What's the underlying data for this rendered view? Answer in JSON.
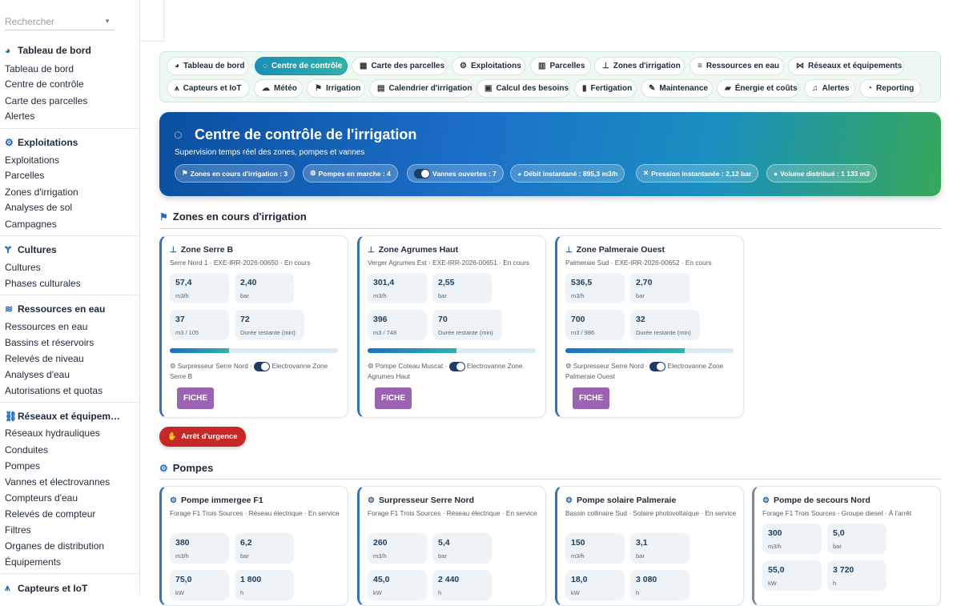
{
  "sidebar": {
    "search_placeholder": "Rechercher",
    "sections": [
      {
        "title": "Tableau de bord",
        "icon": "gauge-icon",
        "items": [
          "Tableau de bord",
          "Centre de contrôle",
          "Carte des parcelles",
          "Alertes"
        ]
      },
      {
        "title": "Exploitations",
        "icon": "tractor-icon",
        "items": [
          "Exploitations",
          "Parcelles",
          "Zones d'irrigation",
          "Analyses de sol",
          "Campagnes"
        ]
      },
      {
        "title": "Cultures",
        "icon": "seedling-icon",
        "items": [
          "Cultures",
          "Phases culturales"
        ]
      },
      {
        "title": "Ressources en eau",
        "icon": "water-icon",
        "items": [
          "Ressources en eau",
          "Bassins et réservoirs",
          "Relevés de niveau",
          "Analyses d'eau",
          "Autorisations et quotas"
        ]
      },
      {
        "title": "Réseaux et équipem…",
        "icon": "network-icon",
        "items": [
          "Réseaux hydrauliques",
          "Conduites",
          "Pompes",
          "Vannes et électrovannes",
          "Compteurs d'eau",
          "Relevés de compteur",
          "Filtres",
          "Organes de distribution",
          "Équipements"
        ]
      },
      {
        "title": "Capteurs et IoT",
        "icon": "antenna-icon",
        "items": []
      }
    ]
  },
  "tabs": [
    {
      "label": "Tableau de bord",
      "icon": "gauge-icon",
      "active": false
    },
    {
      "label": "Centre de contrôle",
      "icon": "satellite-dish-icon",
      "active": true
    },
    {
      "label": "Carte des parcelles",
      "icon": "map-grid-icon",
      "active": false
    },
    {
      "label": "Exploitations",
      "icon": "tractor-icon",
      "active": false
    },
    {
      "label": "Parcelles",
      "icon": "map-icon",
      "active": false
    },
    {
      "label": "Zones d'irrigation",
      "icon": "sitemap-icon",
      "active": false
    },
    {
      "label": "Ressources en eau",
      "icon": "water-icon",
      "active": false
    },
    {
      "label": "Réseaux et équipements",
      "icon": "network-icon",
      "active": false
    },
    {
      "label": "Capteurs et IoT",
      "icon": "antenna-icon",
      "active": false
    },
    {
      "label": "Météo",
      "icon": "cloud-sun-icon",
      "active": false
    },
    {
      "label": "Irrigation",
      "icon": "faucet-icon",
      "active": false
    },
    {
      "label": "Calendrier d'irrigation",
      "icon": "calendar-icon",
      "active": false
    },
    {
      "label": "Calcul des besoins",
      "icon": "calculator-icon",
      "active": false
    },
    {
      "label": "Fertigation",
      "icon": "flask-icon",
      "active": false
    },
    {
      "label": "Maintenance",
      "icon": "wrench-icon",
      "active": false
    },
    {
      "label": "Énergie et coûts",
      "icon": "money-icon",
      "active": false
    },
    {
      "label": "Alertes",
      "icon": "bell-icon",
      "active": false
    },
    {
      "label": "Reporting",
      "icon": "pie-chart-icon",
      "active": false
    }
  ],
  "hero": {
    "title": "Centre de contrôle de l'irrigation",
    "subtitle": "Supervision temps réel des zones, pompes et vannes",
    "chips": [
      {
        "text": "Zones en cours d'irrigation : 3",
        "icon": "faucet-icon"
      },
      {
        "text": "Pompes en marche : 4",
        "icon": "cogs-icon"
      },
      {
        "text": "Vannes ouvertes : 7",
        "icon": "toggle-icon"
      },
      {
        "text": "Débit instantané : 895,3 m3/h",
        "icon": "gauge-icon"
      },
      {
        "text": "Pression instantanée : 2,12 bar",
        "icon": "compress-icon"
      },
      {
        "text": "Volume distribué : 1 133 m3",
        "icon": "droplet-icon"
      }
    ]
  },
  "zones_section": {
    "title": "Zones en cours d'irrigation"
  },
  "zones": [
    {
      "name": "Zone Serre B",
      "sub": "Serre Nord 1 · EXE-IRR-2026-00650 · En cours",
      "flow": "57,4",
      "flow_unit": "m3/h",
      "pressure": "2,40",
      "pressure_unit": "bar",
      "volume": "37",
      "volume_unit": "m3 / 105",
      "remaining": "72",
      "remaining_unit": "Durée restante (min)",
      "progress": 0.35,
      "equip_pump": "Surpresseur Serre Nord ·",
      "equip_valve": "Electrovanne Zone Serre B",
      "button": "FICHE"
    },
    {
      "name": "Zone Agrumes Haut",
      "sub": "Verger Agrumes Est · EXE-IRR-2026-00651 · En cours",
      "flow": "301,4",
      "flow_unit": "m3/h",
      "pressure": "2,55",
      "pressure_unit": "bar",
      "volume": "396",
      "volume_unit": "m3 / 748",
      "remaining": "70",
      "remaining_unit": "Durée restante (min)",
      "progress": 0.53,
      "equip_pump": "Pompe Coteau Muscat ·",
      "equip_valve": "Electrovanne Zone Agrumes Haut",
      "button": "FICHE"
    },
    {
      "name": "Zone Palmeraie Ouest",
      "sub": "Palmeraie Sud · EXE-IRR-2026-00652 · En cours",
      "flow": "536,5",
      "flow_unit": "m3/h",
      "pressure": "2,70",
      "pressure_unit": "bar",
      "volume": "700",
      "volume_unit": "m3 / 986",
      "remaining": "32",
      "remaining_unit": "Durée restante (min)",
      "progress": 0.71,
      "equip_pump": "Surpresseur Serre Nord ·",
      "equip_valve": "Electrovanne Zone Palmeraie Ouest",
      "button": "FICHE"
    }
  ],
  "emergency_button": "Arrêt d'urgence",
  "pumps_section": {
    "title": "Pompes"
  },
  "pumps": [
    {
      "name": "Pompe immergee F1",
      "sub": "Forage F1 Trois Sources · Réseau électrique · En service",
      "flow": "380",
      "flow_unit": "m3/h",
      "pressure": "6,2",
      "pressure_unit": "bar",
      "power": "75,0",
      "power_unit": "kW",
      "hours": "1 800",
      "hours_unit": "h"
    },
    {
      "name": "Surpresseur Serre Nord",
      "sub": "Forage F1 Trois Sources · Réseau électrique · En service",
      "flow": "260",
      "flow_unit": "m3/h",
      "pressure": "5,4",
      "pressure_unit": "bar",
      "power": "45,0",
      "power_unit": "kW",
      "hours": "2 440",
      "hours_unit": "h"
    },
    {
      "name": "Pompe solaire Palmeraie",
      "sub": "Bassin collinaire Sud · Solaire photovoltaïque · En service",
      "flow": "150",
      "flow_unit": "m3/h",
      "pressure": "3,1",
      "pressure_unit": "bar",
      "power": "18,0",
      "power_unit": "kW",
      "hours": "3 080",
      "hours_unit": "h"
    },
    {
      "name": "Pompe de secours Nord",
      "sub": "Forage F1 Trois Sources · Groupe diesel · À l'arrêt",
      "flow": "300",
      "flow_unit": "m3/h",
      "pressure": "5,0",
      "pressure_unit": "bar",
      "power": "55,0",
      "power_unit": "kW",
      "hours": "3 720",
      "hours_unit": "h"
    }
  ]
}
